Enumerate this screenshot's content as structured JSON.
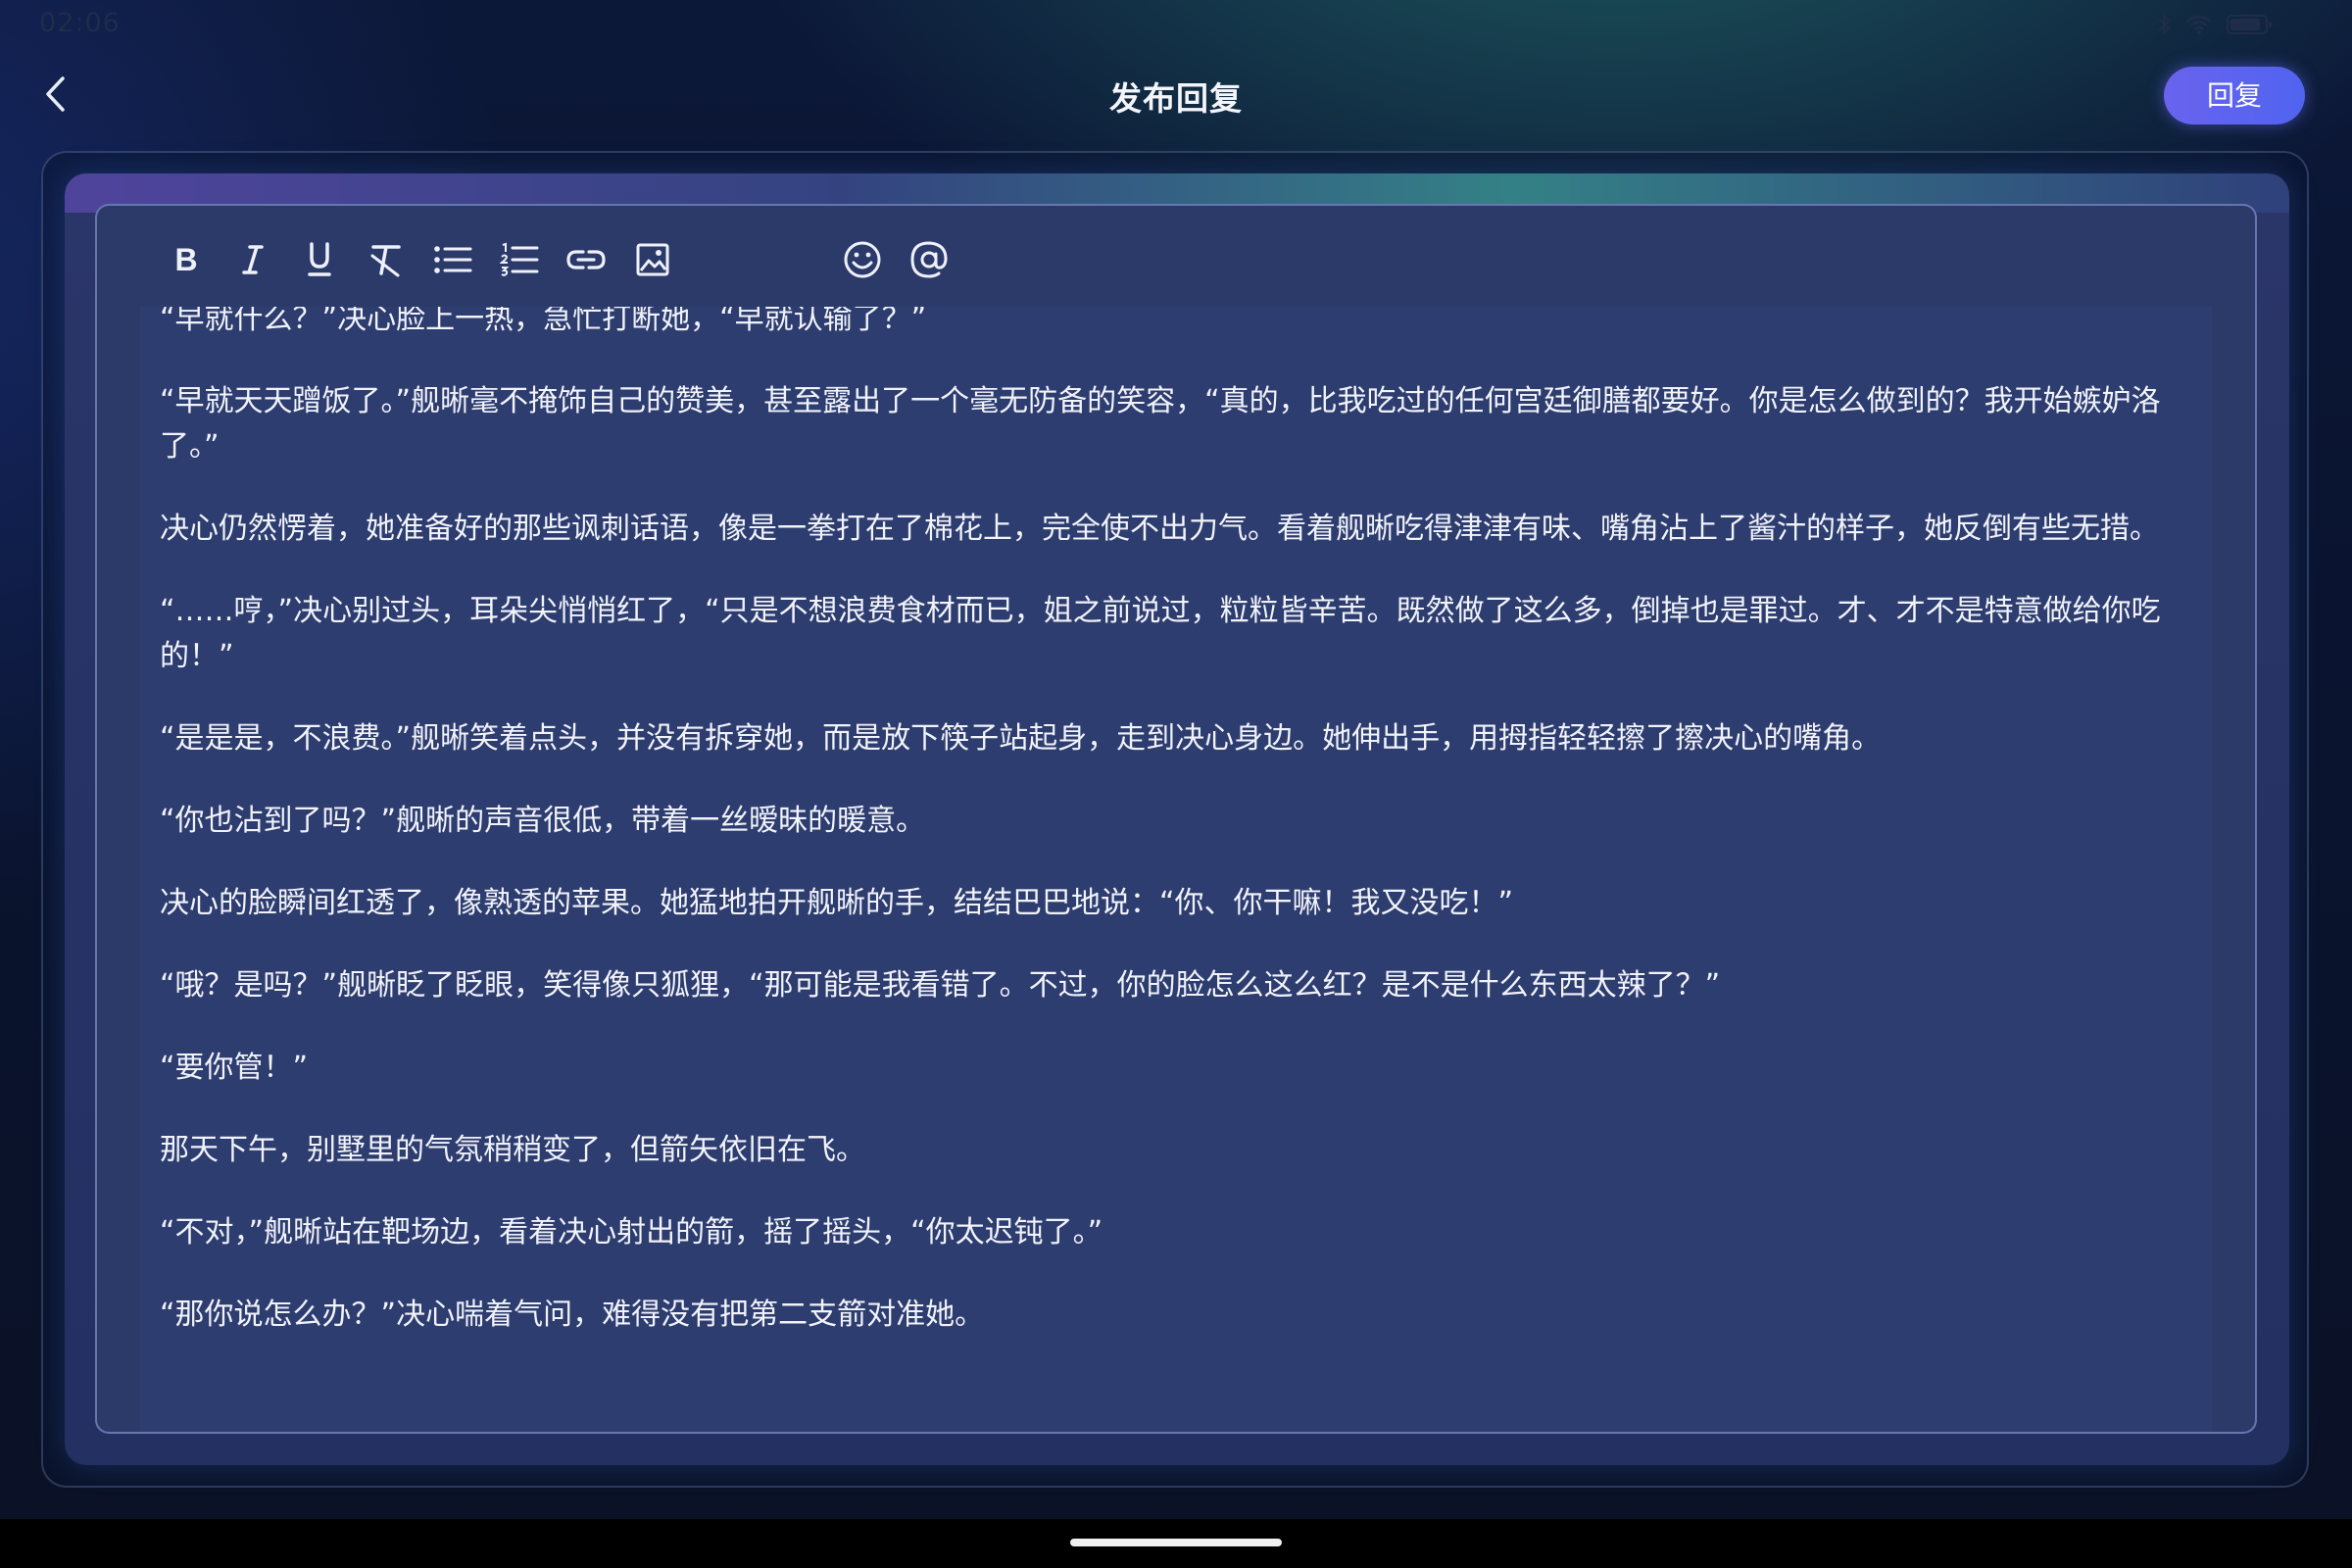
{
  "status_bar": {
    "time": "02:06",
    "icons": [
      "bluetooth-icon",
      "wifi-icon",
      "battery-icon"
    ],
    "battery_level": "80"
  },
  "header": {
    "title": "发布回复",
    "back_icon": "chevron-left-icon",
    "reply_label": "回复"
  },
  "toolbar": {
    "tools": [
      {
        "name": "bold-icon",
        "glyph": "B"
      },
      {
        "name": "italic-icon",
        "glyph": "I"
      },
      {
        "name": "underline-icon",
        "glyph": "U"
      },
      {
        "name": "clear-format-icon",
        "glyph": "T"
      },
      {
        "name": "bullet-list-icon"
      },
      {
        "name": "numbered-list-icon"
      },
      {
        "name": "link-icon"
      },
      {
        "name": "image-icon"
      },
      {
        "name": "emoji-icon"
      },
      {
        "name": "mention-icon"
      }
    ]
  },
  "editor": {
    "paragraphs": [
      "“早就什么？”决心脸上一热，急忙打断她，“早就认输了？”",
      "“早就天天蹭饭了。”舰晰毫不掩饰自己的赞美，甚至露出了一个毫无防备的笑容，“真的，比我吃过的任何宫廷御膳都要好。你是怎么做到的？我开始嫉妒洛了。”",
      "决心仍然愣着，她准备好的那些讽刺话语，像是一拳打在了棉花上，完全使不出力气。看着舰晰吃得津津有味、嘴角沾上了酱汁的样子，她反倒有些无措。",
      "“……哼，”决心别过头，耳朵尖悄悄红了，“只是不想浪费食材而已，姐之前说过，粒粒皆辛苦。既然做了这么多，倒掉也是罪过。才、才不是特意做给你吃的！”",
      "“是是是，不浪费。”舰晰笑着点头，并没有拆穿她，而是放下筷子站起身，走到决心身边。她伸出手，用拇指轻轻擦了擦决心的嘴角。",
      "“你也沾到了吗？”舰晰的声音很低，带着一丝暧昧的暖意。",
      "决心的脸瞬间红透了，像熟透的苹果。她猛地拍开舰晰的手，结结巴巴地说：“你、你干嘛！我又没吃！”",
      "“哦？是吗？”舰晰眨了眨眼，笑得像只狐狸，“那可能是我看错了。不过，你的脸怎么这么红？是不是什么东西太辣了？”",
      "“要你管！”",
      "那天下午，别墅里的气氛稍稍变了，但箭矢依旧在飞。",
      "“不对，”舰晰站在靶场边，看着决心射出的箭，摇了摇头，“你太迟钝了。”",
      "“那你说怎么办？”决心喘着气问，难得没有把第二支箭对准她。"
    ]
  }
}
